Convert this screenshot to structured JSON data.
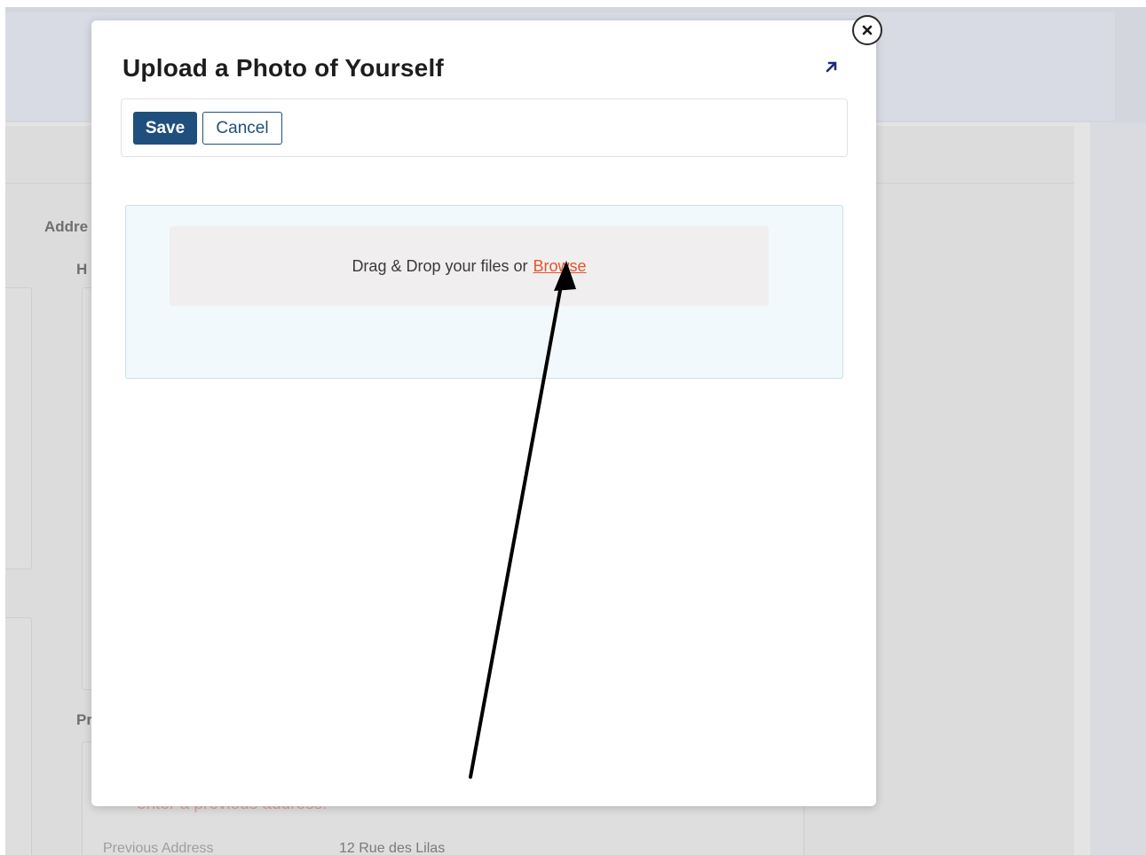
{
  "background": {
    "section_label": "Addre",
    "sub_label_1": "H",
    "sub_label_2": "Pr",
    "error_text": "enter a previous address.",
    "previous_address_label": "Previous Address",
    "previous_address_value": "12 Rue des Lilas"
  },
  "modal": {
    "title": "Upload a Photo of Yourself",
    "expand_icon": "external-link-arrow-icon",
    "close_icon": "close-x-icon",
    "toolbar": {
      "save_label": "Save",
      "cancel_label": "Cancel"
    },
    "upload": {
      "prompt": "Drag & Drop your files or",
      "browse_label": "Browse"
    }
  },
  "colors": {
    "primary": "#1f4f7c",
    "browse_link": "#e2552f",
    "upload_bg": "#f2f9fc",
    "dropzone_bg": "#f0eeee"
  },
  "annotation": {
    "type": "arrow pointing to Browse link",
    "color": "#000000"
  }
}
